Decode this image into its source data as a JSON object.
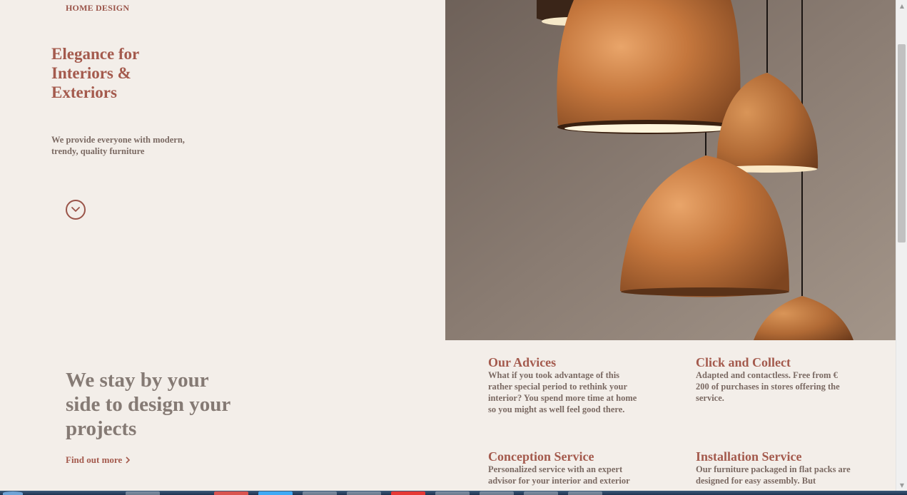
{
  "brand": "HOME DESIGN",
  "hero": {
    "title": "Elegance for Interiors & Exteriors",
    "subtitle": "We provide everyone with modern, trendy, quality furniture"
  },
  "section": {
    "title": "We stay by your side to design your projects",
    "link": "Find out more"
  },
  "services": [
    {
      "title": "Our Advices",
      "text": "What if you took advantage of this rather special period to rethink your interior? You spend more time at home so you might as well feel good there."
    },
    {
      "title": "Click and Collect",
      "text": "Adapted and contactless. Free from € 200 of purchases in stores offering the service."
    },
    {
      "title": "Conception Service",
      "text": "Personalized service with an expert advisor for your interior and exterior"
    },
    {
      "title": "Installation Service",
      "text": "Our furniture packaged in flat packs are designed for easy assembly. But"
    }
  ],
  "colors": {
    "background": "#f3eee9",
    "accent": "#a45a4d",
    "text_muted": "#7b6a63",
    "heading_gray": "#857a74"
  },
  "icons": {
    "scroll_down": "chevron-down-circle-icon",
    "link_arrow": "chevron-right-icon"
  }
}
